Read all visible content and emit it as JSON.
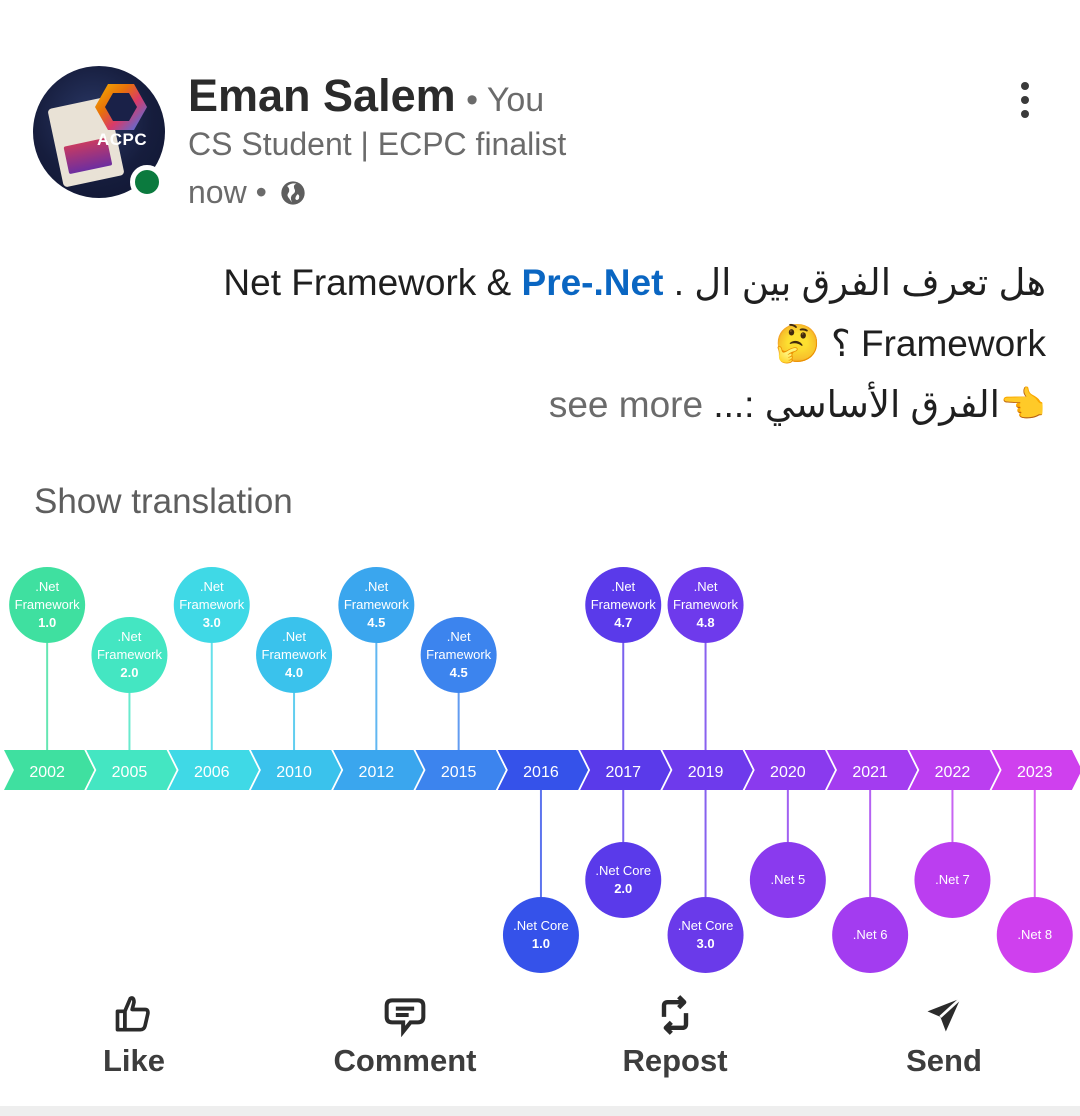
{
  "post": {
    "author_name": "Eman Salem",
    "author_relation": "• You",
    "author_headline": "CS Student | ECPC finalist",
    "timestamp": "now •",
    "avatar_text": "ACPC",
    "text_line1_rtl": "هل تعرف الفرق بين ال .",
    "text_hashtag": "Pre-.Net",
    "text_line1_ltr": "Net Framework & ",
    "text_line2": "؟ Framework",
    "text_line2_emoji": "🤔",
    "text_line3_emoji": "👈",
    "text_line3": "الفرق الأساسي :...",
    "see_more": "see more",
    "show_translation": "Show translation"
  },
  "timeline": {
    "years": [
      "2002",
      "2005",
      "2006",
      "2010",
      "2012",
      "2015",
      "2016",
      "2017",
      "2019",
      "2020",
      "2021",
      "2022",
      "2023"
    ],
    "milestones": [
      {
        "year": "2002",
        "line1": ".Net",
        "line2": "Framework",
        "line3": "1.0",
        "side": "top",
        "level": "high",
        "color": "#3fe0a0"
      },
      {
        "year": "2005",
        "line1": ".Net",
        "line2": "Framework",
        "line3": "2.0",
        "side": "top",
        "level": "low",
        "color": "#44e6c2"
      },
      {
        "year": "2006",
        "line1": ".Net",
        "line2": "Framework",
        "line3": "3.0",
        "side": "top",
        "level": "high",
        "color": "#3fd9e6"
      },
      {
        "year": "2010",
        "line1": ".Net",
        "line2": "Framework",
        "line3": "4.0",
        "side": "top",
        "level": "low",
        "color": "#3ac2ec"
      },
      {
        "year": "2012",
        "line1": ".Net",
        "line2": "Framework",
        "line3": "4.5",
        "side": "top",
        "level": "high",
        "color": "#3aa6ee"
      },
      {
        "year": "2015",
        "line1": ".Net",
        "line2": "Framework",
        "line3": "4.5",
        "side": "top",
        "level": "low",
        "color": "#3c84ee"
      },
      {
        "year": "2016",
        "line1": ".Net Core",
        "line2": "1.0",
        "line3": "",
        "side": "bottom",
        "level": "low",
        "color": "#3552ea"
      },
      {
        "year": "2017",
        "line1": ".Net",
        "line2": "Framework",
        "line3": "4.7",
        "side": "top",
        "level": "high",
        "color": "#5a3aea"
      },
      {
        "year": "2017",
        "line1": ".Net Core",
        "line2": "2.0",
        "line3": "",
        "side": "bottom",
        "level": "high",
        "color": "#5a3aea"
      },
      {
        "year": "2019",
        "line1": ".Net",
        "line2": "Framework",
        "line3": "4.8",
        "side": "top",
        "level": "high",
        "color": "#6e3aec"
      },
      {
        "year": "2019",
        "line1": ".Net Core",
        "line2": "3.0",
        "line3": "",
        "side": "bottom",
        "level": "low",
        "color": "#6a3aea"
      },
      {
        "year": "2020",
        "line1": ".Net 5",
        "line2": "",
        "line3": "",
        "side": "bottom",
        "level": "high",
        "color": "#8a3aee"
      },
      {
        "year": "2021",
        "line1": ".Net 6",
        "line2": "",
        "line3": "",
        "side": "bottom",
        "level": "low",
        "color": "#a33cf0"
      },
      {
        "year": "2022",
        "line1": ".Net 7",
        "line2": "",
        "line3": "",
        "side": "bottom",
        "level": "high",
        "color": "#bb3ef0"
      },
      {
        "year": "2023",
        "line1": ".Net 8",
        "line2": "",
        "line3": "",
        "side": "bottom",
        "level": "low",
        "color": "#cf40ee"
      }
    ],
    "band_colors": [
      "#3fe0a0",
      "#44e6c2",
      "#3fd9e6",
      "#3ac2ec",
      "#3aa6ee",
      "#3c84ee",
      "#3552ea",
      "#5a3aea",
      "#6e3aec",
      "#8a3aee",
      "#a33cf0",
      "#bb3ef0",
      "#cf40ee"
    ]
  },
  "actions": [
    {
      "label": "Like",
      "icon": "thumbs-up-icon"
    },
    {
      "label": "Comment",
      "icon": "comment-icon"
    },
    {
      "label": "Repost",
      "icon": "repost-icon"
    },
    {
      "label": "Send",
      "icon": "send-icon"
    }
  ]
}
